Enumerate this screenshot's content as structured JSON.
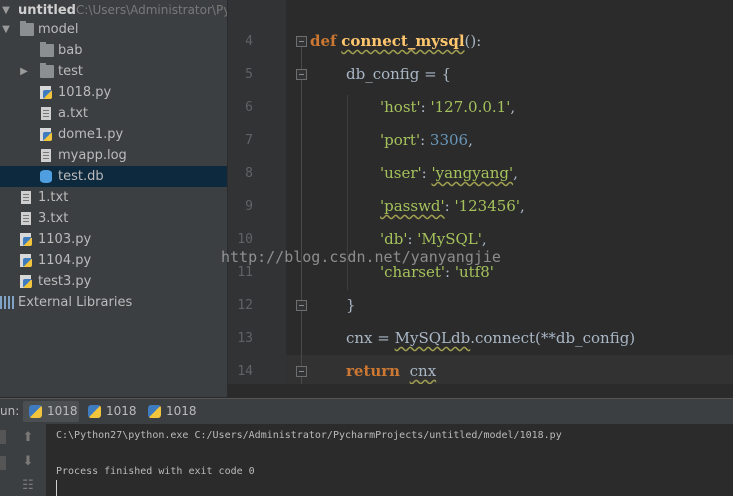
{
  "project": {
    "root_name": "untitled",
    "root_path": "C:\\Users\\Administrator\\Py",
    "items": [
      {
        "label": "model",
        "kind": "folder",
        "expanded": true
      },
      {
        "label": "bab",
        "kind": "folder"
      },
      {
        "label": "test",
        "kind": "folder",
        "expanded": false
      },
      {
        "label": "1018.py",
        "kind": "py"
      },
      {
        "label": "a.txt",
        "kind": "txt"
      },
      {
        "label": "dome1.py",
        "kind": "py"
      },
      {
        "label": "myapp.log",
        "kind": "txt"
      },
      {
        "label": "test.db",
        "kind": "db",
        "selected": true
      },
      {
        "label": "1.txt",
        "kind": "txt"
      },
      {
        "label": "3.txt",
        "kind": "txt"
      },
      {
        "label": "1103.py",
        "kind": "py"
      },
      {
        "label": "1104.py",
        "kind": "py"
      },
      {
        "label": "test3.py",
        "kind": "py"
      },
      {
        "label": "External Libraries",
        "kind": "libs"
      }
    ]
  },
  "editor": {
    "line_numbers": [
      "4",
      "5",
      "6",
      "7",
      "8",
      "9",
      "10",
      "11",
      "12",
      "13",
      "14"
    ],
    "code": {
      "l4_kw": "def",
      "l4_fn": "connect_mysql",
      "l4_rest": "():",
      "l5": "db_config = {",
      "l6_key": "'host'",
      "l6_val": "'127.0.0.1'",
      "l7_key": "'port'",
      "l7_val": "3306",
      "l8_key": "'user'",
      "l8_val": "'yangyang'",
      "l9_key": "'passwd'",
      "l9_val": "'123456'",
      "l10_key": "'db'",
      "l10_val": "'MySQL'",
      "l11_key": "'charset'",
      "l11_val": "'utf8'",
      "l12": "}",
      "l13_a": "cnx = ",
      "l13_b": "MySQLdb",
      "l13_c": ".connect(**db_config)",
      "l14_kw": "return",
      "l14_var": "cnx",
      "colon": ": ",
      "comma": ","
    }
  },
  "watermark": "http://blog.csdn.net/yanyangjie",
  "run": {
    "title": "un:",
    "tabs": [
      "1018",
      "1018",
      "1018"
    ],
    "active_tab": 0,
    "output": {
      "command": "C:\\Python27\\python.exe C:/Users/Administrator/PycharmProjects/untitled/model/1018.py",
      "exit": "Process finished with exit code 0"
    }
  },
  "colors": {
    "keyword": "#cc7832",
    "function": "#ffc66d",
    "string": "#a5c25c",
    "number": "#6897bb",
    "selection": "#0d293e"
  }
}
